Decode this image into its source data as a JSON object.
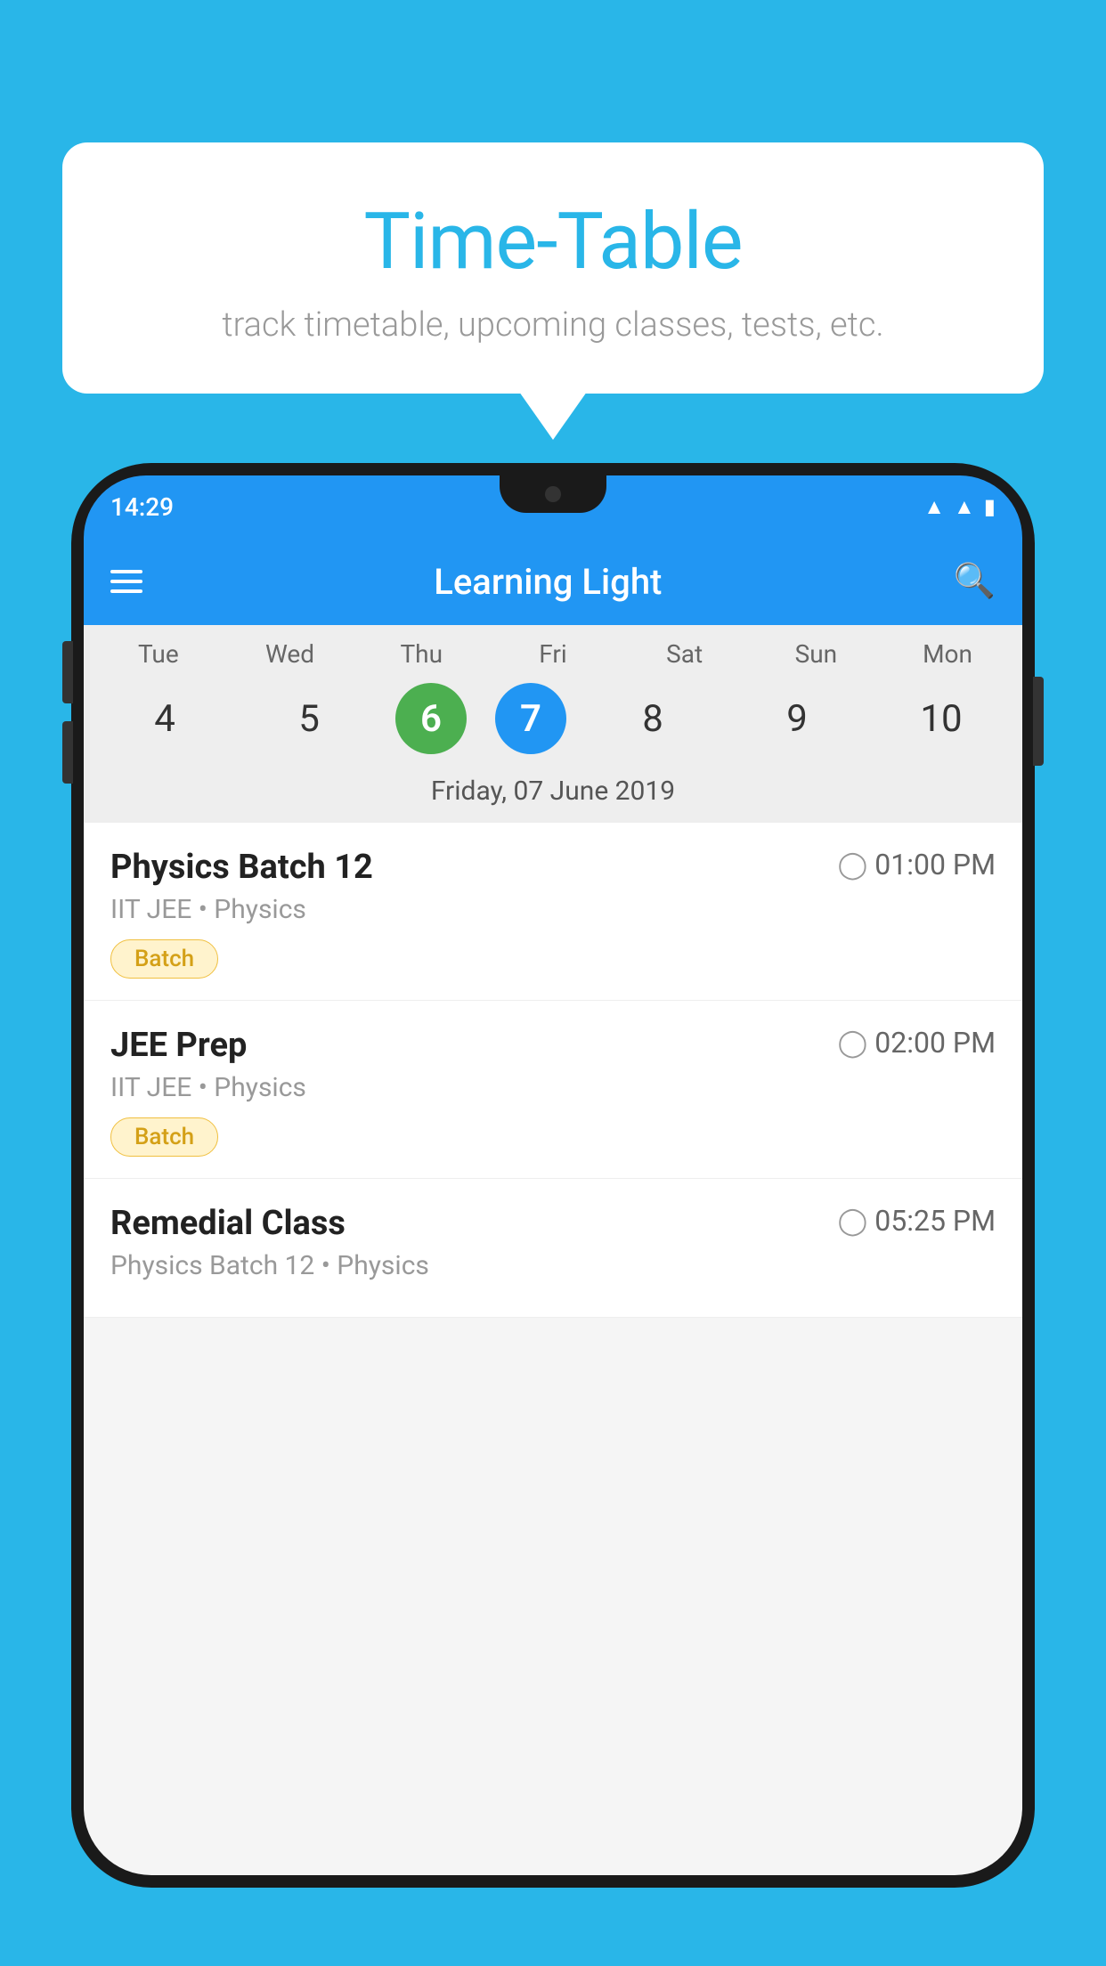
{
  "background_color": "#29B6E8",
  "speech_bubble": {
    "title": "Time-Table",
    "subtitle": "track timetable, upcoming classes, tests, etc."
  },
  "phone": {
    "status_bar": {
      "time": "14:29",
      "icons": [
        "wifi",
        "signal",
        "battery"
      ]
    },
    "app_header": {
      "title": "Learning Light"
    },
    "calendar": {
      "days": [
        "Tue",
        "Wed",
        "Thu",
        "Fri",
        "Sat",
        "Sun",
        "Mon"
      ],
      "dates": [
        "4",
        "5",
        "6",
        "7",
        "8",
        "9",
        "10"
      ],
      "today_index": 2,
      "selected_index": 3,
      "selected_date_label": "Friday, 07 June 2019"
    },
    "schedule_items": [
      {
        "title": "Physics Batch 12",
        "time": "01:00 PM",
        "subtitle": "IIT JEE • Physics",
        "tag": "Batch"
      },
      {
        "title": "JEE Prep",
        "time": "02:00 PM",
        "subtitle": "IIT JEE • Physics",
        "tag": "Batch"
      },
      {
        "title": "Remedial Class",
        "time": "05:25 PM",
        "subtitle": "Physics Batch 12 • Physics",
        "tag": ""
      }
    ]
  }
}
